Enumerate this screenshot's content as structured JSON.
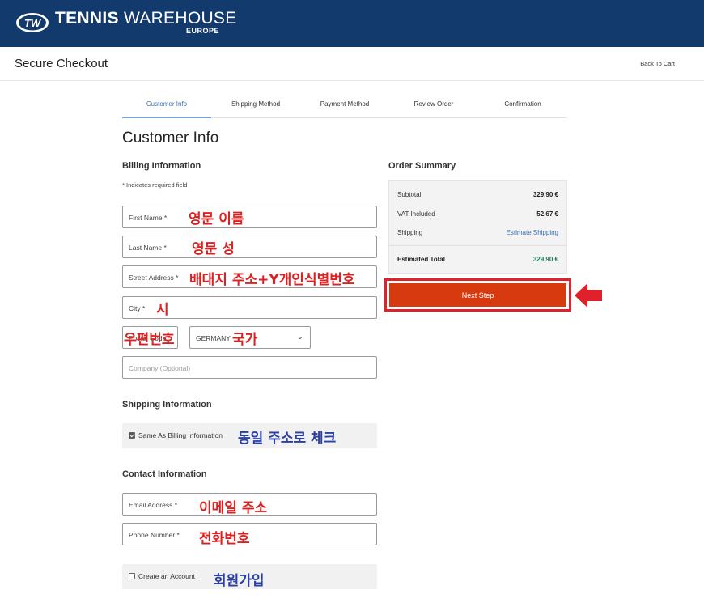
{
  "header": {
    "logo_text": "TW",
    "brand_bold": "TENNIS",
    "brand_light": " WAREHOUSE",
    "brand_sub": "EUROPE",
    "page_heading": "Secure Checkout",
    "back_link": "Back To Cart"
  },
  "steps": [
    {
      "label": "Customer Info",
      "active": true
    },
    {
      "label": "Shipping Method"
    },
    {
      "label": "Payment Method"
    },
    {
      "label": "Review Order"
    },
    {
      "label": "Confirmation"
    }
  ],
  "main_title": "Customer Info",
  "billing": {
    "title": "Billing Information",
    "required_note": "* Indicates required field",
    "fields": {
      "first_name": "First Name *",
      "last_name": "Last Name *",
      "street": "Street Address *",
      "city": "City *",
      "postal": "Postal Code *",
      "country": "GERMANY",
      "company": "Company (Optional)"
    }
  },
  "shipping": {
    "title": "Shipping Information",
    "same_as_billing": "Same As Billing Information"
  },
  "contact": {
    "title": "Contact Information",
    "email": "Email Address *",
    "phone": "Phone Number *",
    "create_account": "Create an Account"
  },
  "summary": {
    "title": "Order Summary",
    "subtotal_label": "Subtotal",
    "subtotal_value": "329,90 €",
    "vat_label": "VAT Included",
    "vat_value": "52,67 €",
    "shipping_label": "Shipping",
    "shipping_value": "Estimate Shipping",
    "total_label": "Estimated Total",
    "total_value": "329,90 €"
  },
  "next_button": "Next Step",
  "annotations": {
    "first_name": "영문 이름",
    "last_name": "영문 성",
    "street": "배대지 주소+Y개인식별번호",
    "city": "시",
    "postal": "우편번호",
    "country": "국가",
    "same_address": "동일 주소로 체크",
    "email": "이메일 주소",
    "phone": "전화번호",
    "signup": "회원가입"
  },
  "colors": {
    "header_bg": "#123a6d",
    "accent_blue": "#3a6fb5",
    "next_button_bg": "#d83a10",
    "total_green": "#1e7a55",
    "annotation_red": "#e02020",
    "annotation_blue": "#2a3fa8"
  }
}
